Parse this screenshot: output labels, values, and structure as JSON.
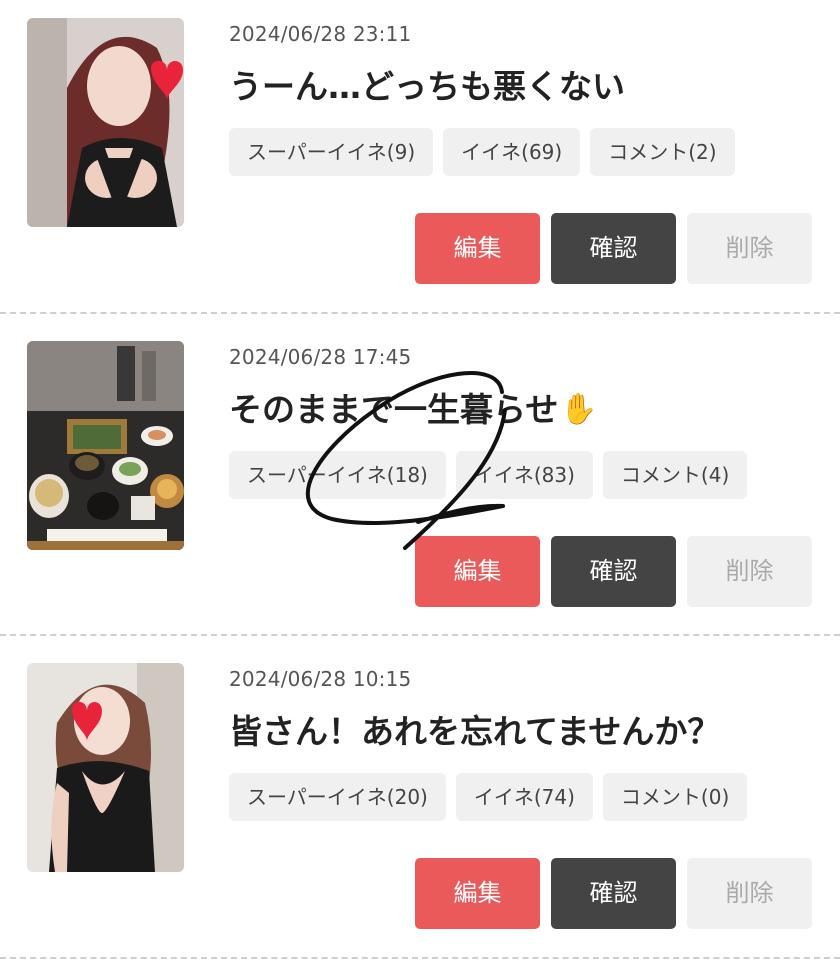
{
  "posts": [
    {
      "timestamp": "2024/06/28 23:11",
      "title": "うーん…どっちも悪くない",
      "title_icon": "",
      "chips": {
        "super_like": "スーパーイイネ(9)",
        "like": "イイネ(69)",
        "comment": "コメント(2)"
      },
      "buttons": {
        "edit": "編集",
        "confirm": "確認",
        "delete": "削除"
      }
    },
    {
      "timestamp": "2024/06/28 17:45",
      "title": "そのままで一生暮らせ",
      "title_icon": "✋",
      "chips": {
        "super_like": "スーパーイイネ(18)",
        "like": "イイネ(83)",
        "comment": "コメント(4)"
      },
      "buttons": {
        "edit": "編集",
        "confirm": "確認",
        "delete": "削除"
      }
    },
    {
      "timestamp": "2024/06/28 10:15",
      "title": "皆さん！あれを忘れてませんか？",
      "title_icon": "",
      "chips": {
        "super_like": "スーパーイイネ(20)",
        "like": "イイネ(74)",
        "comment": "コメント(0)"
      },
      "buttons": {
        "edit": "編集",
        "confirm": "確認",
        "delete": "削除"
      }
    }
  ],
  "colors": {
    "edit_button": "#ea5a5a",
    "confirm_button": "#444444",
    "delete_button": "#f0f0f0",
    "chip_background": "#f0f0f0",
    "heart_sticker": "#e8233a",
    "annotation_scribble": "#111111"
  },
  "icons": {
    "post_1_sticker": "heart-sticker-icon",
    "post_2_title": "raised-hand-icon",
    "post_3_sticker": "heart-sticker-icon",
    "annotation": "hand-drawn-circle-annotation"
  }
}
